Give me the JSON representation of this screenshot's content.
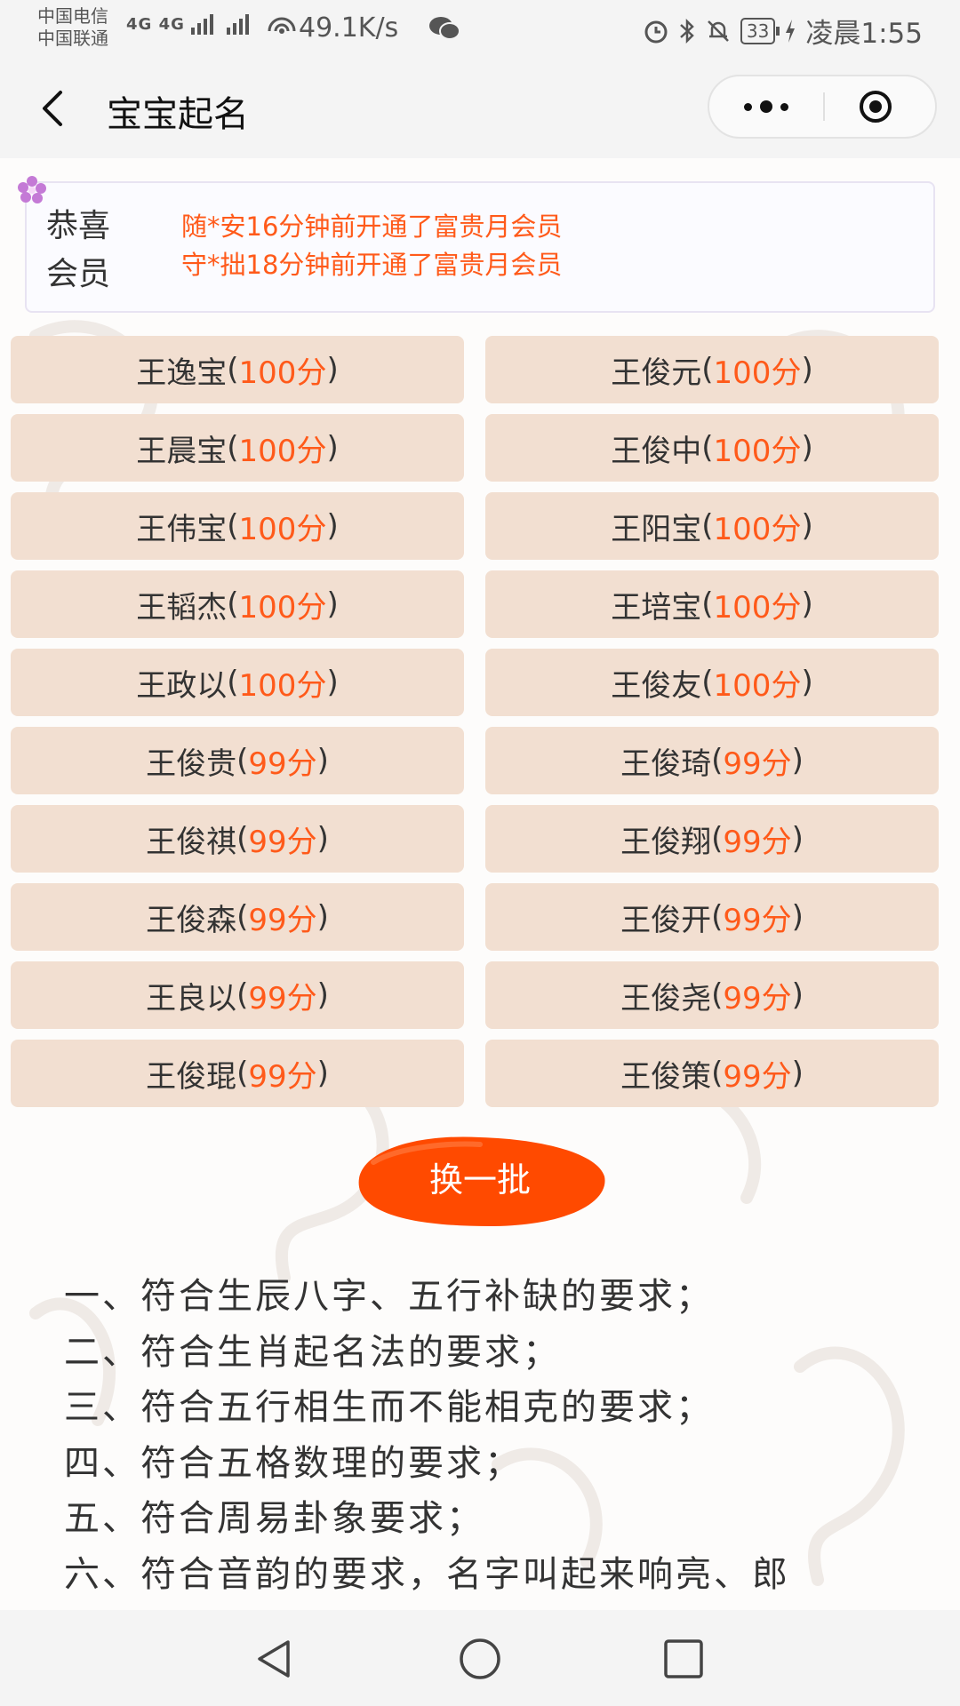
{
  "status_bar": {
    "carrier_1": "中国电信",
    "carrier_2": "中国联通",
    "signal": "4G 4G",
    "net_speed": "49.1K/s",
    "battery": "33",
    "time": "凌晨1:55"
  },
  "navbar": {
    "title": "宝宝起名"
  },
  "notice": {
    "label": "恭喜会员",
    "messages": [
      "随*安16分钟前开通了富贵月会员",
      "守*拙18分钟前开通了富贵月会员"
    ]
  },
  "names": [
    {
      "name": "王逸宝",
      "score": "100分"
    },
    {
      "name": "王俊元",
      "score": "100分"
    },
    {
      "name": "王晨宝",
      "score": "100分"
    },
    {
      "name": "王俊中",
      "score": "100分"
    },
    {
      "name": "王伟宝",
      "score": "100分"
    },
    {
      "name": "王阳宝",
      "score": "100分"
    },
    {
      "name": "王韬杰",
      "score": "100分"
    },
    {
      "name": "王培宝",
      "score": "100分"
    },
    {
      "name": "王政以",
      "score": "100分"
    },
    {
      "name": "王俊友",
      "score": "100分"
    },
    {
      "name": "王俊贵",
      "score": "99分"
    },
    {
      "name": "王俊琦",
      "score": "99分"
    },
    {
      "name": "王俊祺",
      "score": "99分"
    },
    {
      "name": "王俊翔",
      "score": "99分"
    },
    {
      "name": "王俊森",
      "score": "99分"
    },
    {
      "name": "王俊开",
      "score": "99分"
    },
    {
      "name": "王良以",
      "score": "99分"
    },
    {
      "name": "王俊尧",
      "score": "99分"
    },
    {
      "name": "王俊琨",
      "score": "99分"
    },
    {
      "name": "王俊策",
      "score": "99分"
    }
  ],
  "refresh_button": "换一批",
  "requirements": [
    "一、符合生辰八字、五行补缺的要求；",
    "二、符合生肖起名法的要求；",
    "三、符合五行相生而不能相克的要求；",
    "四、符合五格数理的要求；",
    "五、符合周易卦象要求；",
    "六、符合音韵的要求，名字叫起来响亮、郎"
  ],
  "colors": {
    "accent": "#ff5a1a",
    "card_bg": "#f2dfd1",
    "button_bg": "#ff4a00"
  }
}
